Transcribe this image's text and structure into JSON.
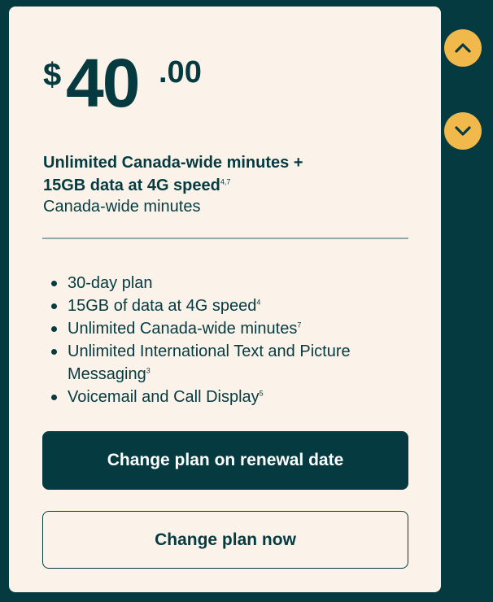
{
  "plan": {
    "currency_symbol": "$",
    "price_dollars": "40",
    "price_cents": ".00",
    "headline_line1": "Unlimited Canada-wide minutes +",
    "headline_line2": "15GB data at 4G speed",
    "headline_footnotes": "4,7",
    "subhead": "Canada-wide minutes"
  },
  "features": [
    {
      "text": "30-day plan",
      "footnote": ""
    },
    {
      "text": "15GB of data at 4G speed",
      "footnote": "4"
    },
    {
      "text": "Unlimited Canada-wide minutes",
      "footnote": "7"
    },
    {
      "text": "Unlimited International Text and Picture Messaging",
      "footnote": "3"
    },
    {
      "text": "Voicemail and Call Display",
      "footnote": "5"
    }
  ],
  "buttons": {
    "renewal_label": "Change plan on renewal date",
    "now_label": "Change plan now"
  },
  "nav": {
    "up_icon": "chevron-up-icon",
    "down_icon": "chevron-down-icon"
  },
  "colors": {
    "background": "#053b40",
    "card": "#fbf3ea",
    "accent": "#f1b94b",
    "text": "#053b40"
  }
}
